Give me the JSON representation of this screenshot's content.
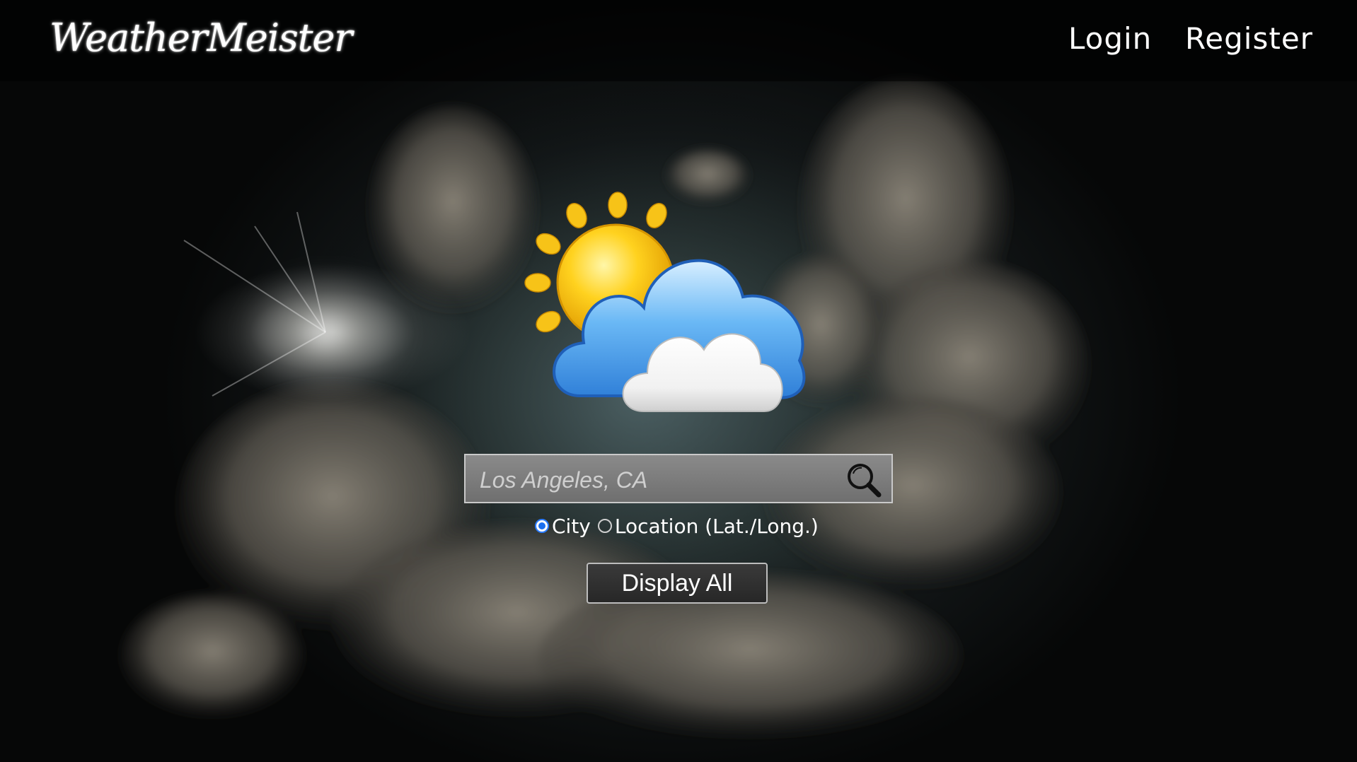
{
  "header": {
    "brand": "WeatherMeister",
    "nav": {
      "login_label": "Login",
      "register_label": "Register"
    }
  },
  "search": {
    "placeholder": "Los Angeles, CA",
    "value": "",
    "icon": "search-icon"
  },
  "search_mode": {
    "options": [
      {
        "label": "City",
        "checked": true
      },
      {
        "label": "Location (Lat./Long.)",
        "checked": false
      }
    ]
  },
  "actions": {
    "display_all_label": "Display All"
  },
  "logo": {
    "icon": "partly-cloudy-icon"
  },
  "colors": {
    "radio_accent": "#1a6ff0",
    "sun": "#f6c21a",
    "cloud_blue": "#4aa3f0"
  }
}
